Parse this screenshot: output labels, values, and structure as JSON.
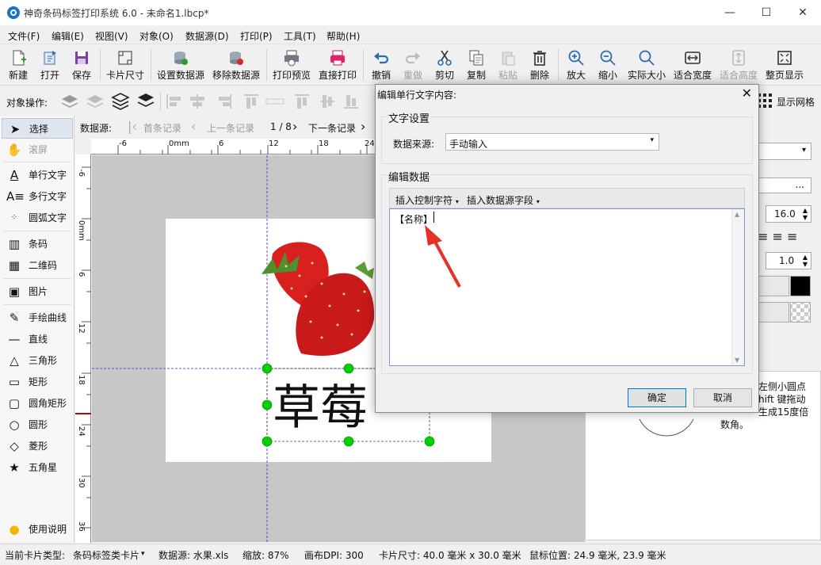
{
  "window": {
    "title": "神奇条码标签打印系统 6.0 - 未命名1.lbcp*",
    "minimize": "—",
    "maximize": "☐",
    "close": "✕"
  },
  "menu": [
    "文件(F)",
    "编辑(E)",
    "视图(V)",
    "对象(O)",
    "数据源(D)",
    "打印(P)",
    "工具(T)",
    "帮助(H)"
  ],
  "toolbar": {
    "new": "新建",
    "open": "打开",
    "save": "保存",
    "card_size": "卡片尺寸",
    "set_ds": "设置数据源",
    "remove_ds": "移除数据源",
    "print_preview": "打印预览",
    "direct_print": "直接打印",
    "undo": "撤销",
    "redo": "重做",
    "cut": "剪切",
    "copy": "复制",
    "paste": "粘贴",
    "delete": "删除",
    "zoom_in": "放大",
    "zoom_out": "缩小",
    "actual_size": "实际大小",
    "fit_width": "适合宽度",
    "fit_height": "适合高度",
    "full_page": "整页显示"
  },
  "ops": {
    "label": "对象操作:",
    "show_grid": "显示网格"
  },
  "tools": {
    "select": "选择",
    "pan": "滚屏",
    "single_text": "单行文字",
    "multi_text": "多行文字",
    "arc_text": "圆弧文字",
    "barcode": "条码",
    "qrcode": "二维码",
    "image": "图片",
    "freehand": "手绘曲线",
    "line": "直线",
    "triangle": "三角形",
    "rect": "矩形",
    "round_rect": "圆角矩形",
    "ellipse": "圆形",
    "diamond": "菱形",
    "star": "五角星",
    "help": "使用说明"
  },
  "datasource": {
    "label": "数据源:",
    "first": "首条记录",
    "prev": "上一条记录",
    "position": "1 / 8",
    "next": "下一条记录"
  },
  "hruler": [
    "-6",
    "0mm",
    "6",
    "12",
    "18",
    "24"
  ],
  "vruler": [
    "-6",
    "0mm",
    "6",
    "12",
    "18",
    "24",
    "30",
    "36"
  ],
  "canvas": {
    "text": "草莓"
  },
  "right_panel": {
    "font_size": "16.0",
    "line_space": "1.0",
    "ellipsis": "...",
    "hint_line1": "左侧小圆点",
    "hint_line2": "hift 键拖动",
    "hint_line3": "生成15度倍",
    "hint_line4": "数角。"
  },
  "status": {
    "card_type_label": "当前卡片类型:",
    "card_type": "条码标签类卡片",
    "datasource": "数据源: 水果.xls",
    "zoom": "缩放: 87%",
    "dpi": "画布DPI: 300",
    "card_size": "卡片尺寸: 40.0 毫米 x 30.0 毫米",
    "mouse": "鼠标位置: 24.9 毫米, 23.9 毫米"
  },
  "dialog": {
    "title": "编辑单行文字内容:",
    "text_settings": "文字设置",
    "source_label": "数据来源:",
    "source_value": "手动输入",
    "edit_data": "编辑数据",
    "insert_ctrl": "插入控制字符",
    "insert_field": "插入数据源字段",
    "content": "【名称】",
    "ok": "确定",
    "cancel": "取消"
  },
  "colors": {
    "accent": "#0078d7",
    "arrow": "#e8302a",
    "handle": "#00c000"
  }
}
